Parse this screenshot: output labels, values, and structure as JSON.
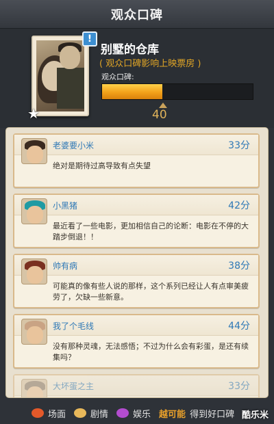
{
  "window": {
    "title": "观众口碑"
  },
  "movie": {
    "title": "别墅的仓库",
    "subtitle": "( 观众口碑影响上映票房 )",
    "reputation_label": "观众口碑:",
    "reputation_value": "40",
    "reputation_progress_percent": 40,
    "alert_badge": "!"
  },
  "reviews": [
    {
      "name": "老婆要小米",
      "score": "33分",
      "text": "绝对是期待过高导致有点失望",
      "hair_color": "#3a2a20"
    },
    {
      "name": "小黑猪",
      "score": "42分",
      "text": "最近看了一些电影，更加相信自己的论断：电影在不停的大踏步倒退！！",
      "hair_color": "#1f9aa3"
    },
    {
      "name": "帅有病",
      "score": "38分",
      "text": "可能真的像有些人说的那样，这个系列已经让人有点审美疲劳了，欠缺一些新意。",
      "hair_color": "#7a3020"
    },
    {
      "name": "我了个毛线",
      "score": "44分",
      "text": "没有那种灵魂，无法感悟；不过为什么会有彩蛋，是还有续集吗？",
      "hair_color": "#c9a384"
    },
    {
      "name": "大坏蛋之主",
      "score": "33分",
      "text": "",
      "hair_color": "#8a7a6a"
    }
  ],
  "footer": {
    "items": [
      {
        "label": "场面",
        "icon": "fire-icon",
        "color": "#e3592a"
      },
      {
        "label": "剧情",
        "icon": "book-icon",
        "color": "#e8b85a"
      },
      {
        "label": "娱乐",
        "icon": "gem-icon",
        "color": "#b34ccf"
      }
    ],
    "hint_highlight": "越可能",
    "hint_rest": "得到好口碑"
  },
  "watermark": "酷乐米"
}
